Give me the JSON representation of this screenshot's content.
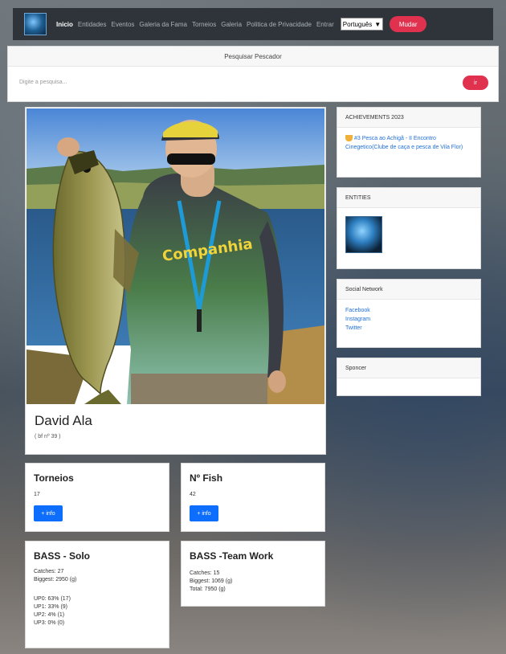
{
  "nav": {
    "links": [
      "Inicio",
      "Entidades",
      "Eventos",
      "Galeria da Fama",
      "Torneios",
      "Galeria",
      "Politica de Privacidade",
      "Entrar"
    ],
    "language": "Português",
    "mudar_label": "Mudar"
  },
  "search": {
    "title": "Pesquisar Pescador",
    "placeholder": "Digite a pesquisa...",
    "button_label": "ir"
  },
  "profile": {
    "name": "David Ala",
    "bf_number": "( bf nº 39 )"
  },
  "achievements": {
    "title": "ACHIEVEMENTS  2023",
    "item": "#3 Pesca ao Achigã - II Encontro Cinegetico(Clube de caça e pesca de Vila Flor)"
  },
  "entities": {
    "title": "ENTITIES"
  },
  "social": {
    "title": "Social Network",
    "links": [
      "Facebook",
      "Instagram",
      "Twitter"
    ]
  },
  "sponsor": {
    "title": "Sponcer"
  },
  "torneios": {
    "title": "Torneios",
    "value": "17",
    "button": "+ info"
  },
  "fish": {
    "title": "Nº Fish",
    "value": "42",
    "button": "+ info"
  },
  "bass_solo": {
    "title": "BASS - Solo",
    "catches": "Catches: 27",
    "biggest": "Biggest: 2950 (g)",
    "up": [
      "UP0: 63% (17)",
      "UP1: 33% (9)",
      "UP2: 4% (1)",
      "UP3: 0% (0)"
    ]
  },
  "bass_team": {
    "title": "BASS -Team Work",
    "catches": "Catches: 15",
    "biggest": "Biggest: 1069 (g)",
    "total": "Total: 7950 (g)"
  }
}
